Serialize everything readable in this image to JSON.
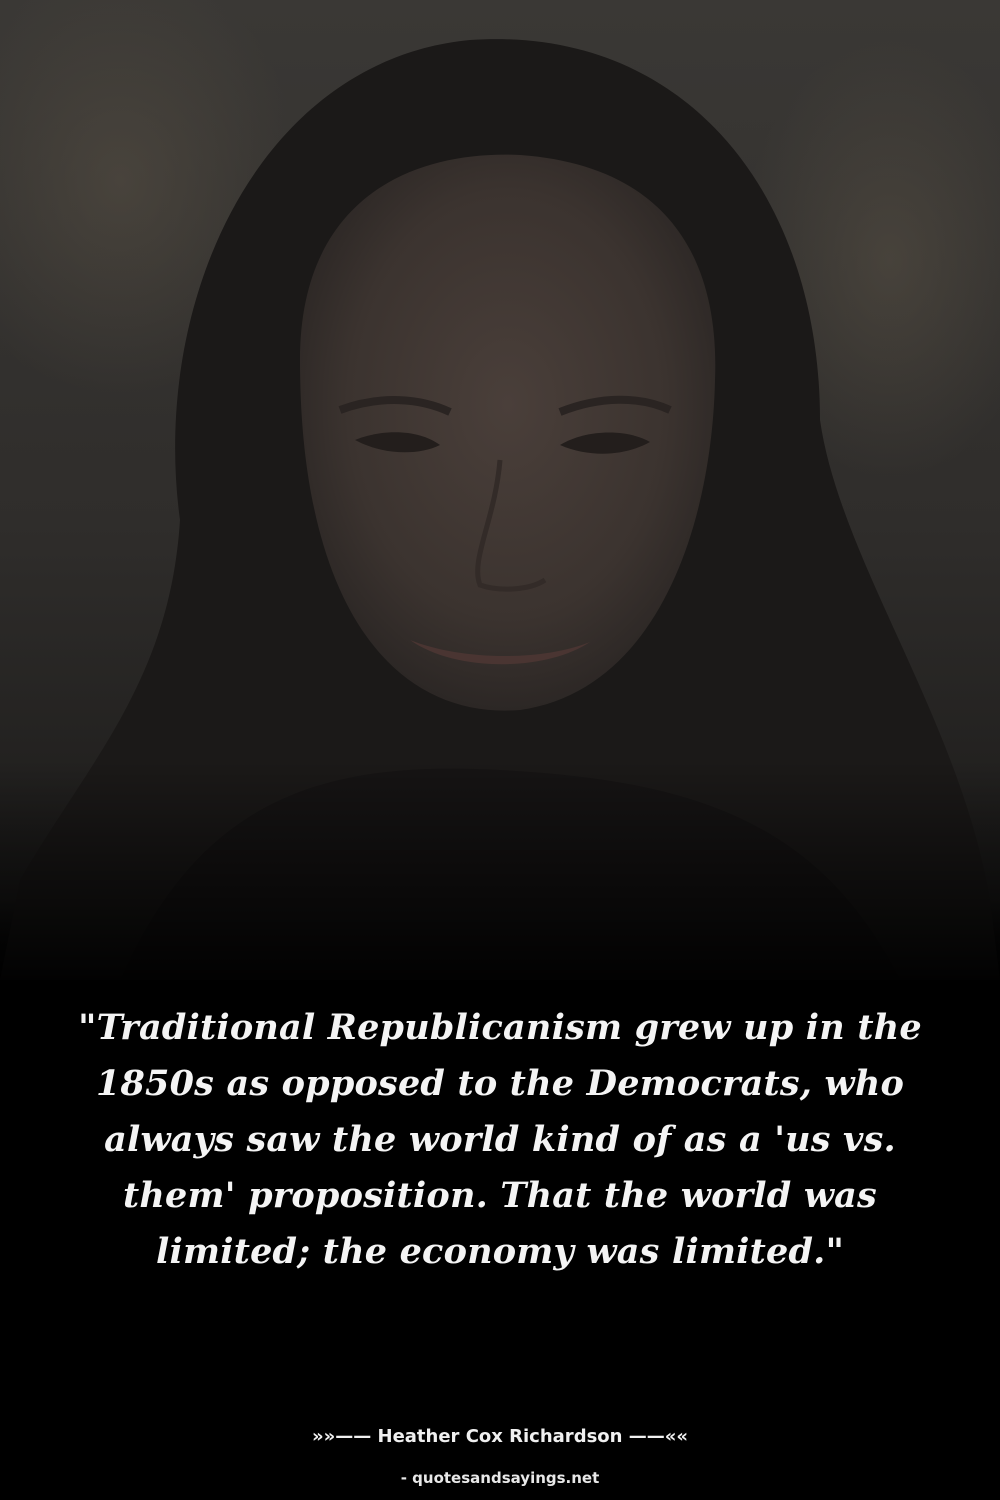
{
  "quote": {
    "text": "\"Traditional Republicanism grew up in the 1850s as opposed to the Democrats, who always saw the world kind of as a 'us vs. them' proposition. That the world was limited; the economy was limited.\""
  },
  "author": {
    "line": "»»—— Heather Cox Richardson ——««"
  },
  "source": {
    "label": "- quotesandsayings.net"
  },
  "colors": {
    "background": "#000000",
    "text": "#f4f4f4"
  }
}
